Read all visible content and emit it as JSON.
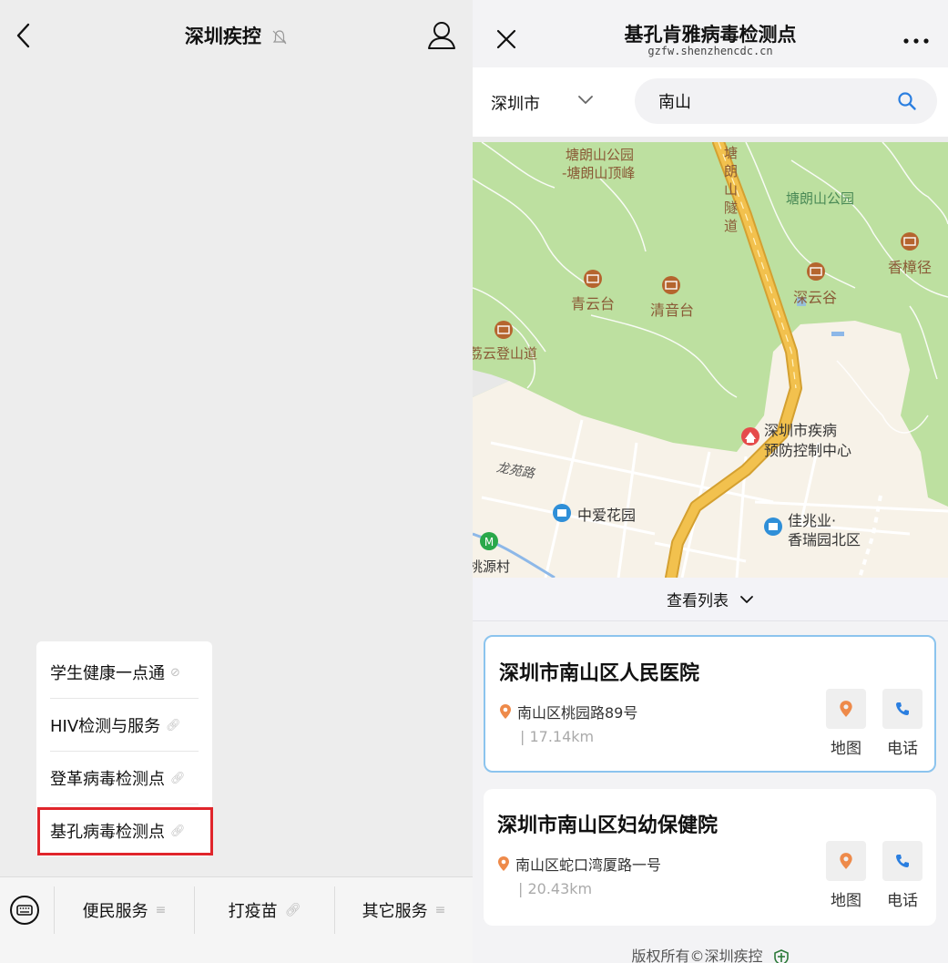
{
  "left": {
    "nav": {
      "title": "深圳疾控"
    },
    "popup": {
      "items": [
        {
          "label": "学生健康一点通"
        },
        {
          "label": "HIV检测与服务"
        },
        {
          "label": "登革病毒检测点"
        },
        {
          "label": "基孔病毒检测点"
        }
      ]
    },
    "bottom_tabs": [
      {
        "label": "便民服务"
      },
      {
        "label": "打疫苗"
      },
      {
        "label": "其它服务"
      }
    ]
  },
  "right": {
    "header": {
      "title": "基孔肯雅病毒检测点",
      "subtitle": "gzfw.shenzhencdc.cn"
    },
    "search": {
      "city": "深圳市",
      "query": "南山"
    },
    "map_labels": {
      "tanglang_peak_1": "塘朗山公园",
      "tanglang_peak_2": "-塘朗山顶峰",
      "tunnel": [
        "塘",
        "朗",
        "山",
        "隧",
        "道"
      ],
      "tanglang_park": "塘朗山公园",
      "xiangzhangjing": "香樟径",
      "qingyuntai": "青云台",
      "qingyintai": "清音台",
      "shenyungu": "深云谷",
      "luoyun_road": "荔云登山道",
      "cdc_line1": "深圳市疾病",
      "cdc_line2": "预防控制中心",
      "longyuan_road": "龙苑路",
      "zhongai_garden": "中爱花园",
      "jiazhaoye_1": "佳兆业·",
      "jiazhaoye_2": "香瑞园北区",
      "taoyuan_village": "桃源村"
    },
    "list_toggle": "查看列表",
    "cards": [
      {
        "name": "深圳市南山区人民医院",
        "address": "南山区桃园路89号",
        "distance": "| 17.14km",
        "map_label": "地图",
        "phone_label": "电话"
      },
      {
        "name": "深圳市南山区妇幼保健院",
        "address": "南山区蛇口湾厦路一号",
        "distance": "| 20.43km",
        "map_label": "地图",
        "phone_label": "电话"
      }
    ],
    "footer": "版权所有©深圳疾控"
  },
  "colors": {
    "highlight_border": "#e0252b",
    "selected_card_border": "#8cc4ee",
    "pin_orange": "#ee8a4a",
    "phone_blue": "#2b7fe0",
    "map_green": "#bde0a0",
    "map_road_yellow": "#f2c14e"
  }
}
